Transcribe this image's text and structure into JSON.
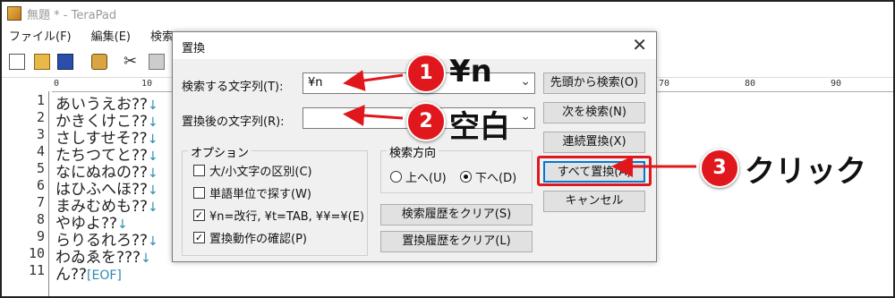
{
  "window": {
    "title": "無題 * - TeraPad",
    "menus": [
      "ファイル(F)",
      "編集(E)",
      "検索(S)"
    ]
  },
  "ruler": {
    "ticks": [
      "0",
      "10",
      "70",
      "80",
      "90"
    ]
  },
  "editor": {
    "line_numbers": [
      "1",
      "2",
      "3",
      "4",
      "5",
      "6",
      "7",
      "8",
      "9",
      "10",
      "11"
    ],
    "lines": [
      {
        "text": "あいうえお??",
        "mark": "↓"
      },
      {
        "text": "かきくけこ??",
        "mark": "↓"
      },
      {
        "text": "さしすせそ??",
        "mark": "↓"
      },
      {
        "text": "たちつてと??",
        "mark": "↓"
      },
      {
        "text": "なにぬねの??",
        "mark": "↓"
      },
      {
        "text": "はひふへほ??",
        "mark": "↓"
      },
      {
        "text": "まみむめも??",
        "mark": "↓"
      },
      {
        "text": "やゆよ??",
        "mark": "↓"
      },
      {
        "text": "らりるれろ??",
        "mark": "↓"
      },
      {
        "text": "わゐゑを???",
        "mark": "↓"
      },
      {
        "text": "ん??",
        "mark": "[EOF]"
      }
    ]
  },
  "dialog": {
    "title": "置換",
    "close": "✕",
    "search_label": "検索する文字列(T):",
    "search_value": "¥n",
    "replace_label": "置換後の文字列(R):",
    "replace_value": "",
    "options_title": "オプション",
    "options": [
      {
        "label": "大/小文字の区別(C)",
        "checked": false
      },
      {
        "label": "単語単位で探す(W)",
        "checked": false
      },
      {
        "label": "¥n=改行, ¥t=TAB, ¥¥=¥(E)",
        "checked": true
      },
      {
        "label": "置換動作の確認(P)",
        "checked": true
      }
    ],
    "direction_title": "検索方向",
    "dir_up": "上へ(U)",
    "dir_down": "下へ(D)",
    "clear_search_history": "検索履歴をクリア(S)",
    "clear_replace_history": "置換履歴をクリア(L)",
    "buttons": {
      "search_from_top": "先頭から検索(O)",
      "find_next": "次を検索(N)",
      "replace_continuous": "連続置換(X)",
      "replace_all": "すべて置換(A)",
      "cancel": "キャンセル"
    }
  },
  "annotations": {
    "step1_number": "1",
    "step1_text": "¥n",
    "step2_number": "2",
    "step2_text": "空白",
    "step3_number": "3",
    "step3_text": "クリック",
    "accent_color": "#e0181e"
  }
}
